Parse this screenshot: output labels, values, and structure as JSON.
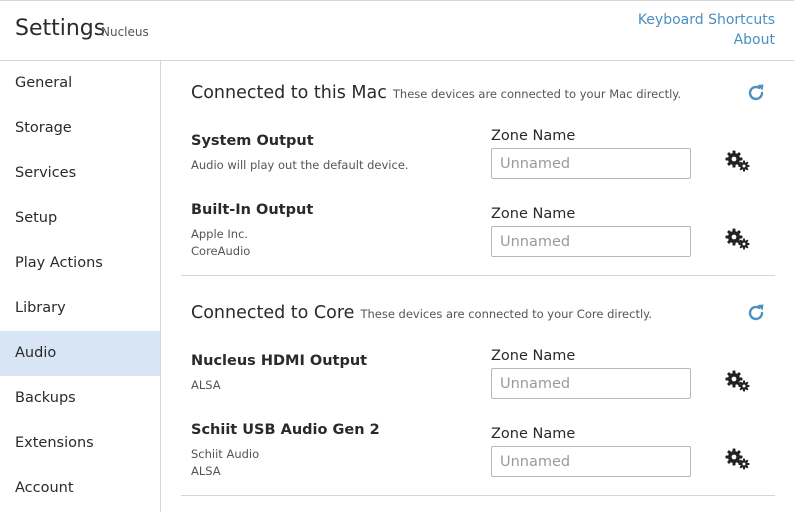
{
  "header": {
    "title": "Settings",
    "subtitle": "Nucleus",
    "keyboard_shortcuts": "Keyboard Shortcuts",
    "about": "About"
  },
  "sidebar": {
    "active": "Audio",
    "items": [
      {
        "label": "General"
      },
      {
        "label": "Storage"
      },
      {
        "label": "Services"
      },
      {
        "label": "Setup"
      },
      {
        "label": "Play Actions"
      },
      {
        "label": "Library"
      },
      {
        "label": "Audio"
      },
      {
        "label": "Backups"
      },
      {
        "label": "Extensions"
      },
      {
        "label": "Account"
      }
    ]
  },
  "sections": [
    {
      "title": "Connected to this Mac",
      "description": "These devices are connected to your Mac directly.",
      "refresh_icon": "refresh-icon",
      "devices": [
        {
          "name": "System Output",
          "sub1": "Audio will play out the default device.",
          "sub2": "",
          "zone_label": "Zone Name",
          "zone_value": "",
          "zone_placeholder": "Unnamed",
          "settings_icon": "gears-icon"
        },
        {
          "name": "Built-In Output",
          "sub1": "Apple Inc.",
          "sub2": "CoreAudio",
          "zone_label": "Zone Name",
          "zone_value": "",
          "zone_placeholder": "Unnamed",
          "settings_icon": "gears-icon"
        }
      ]
    },
    {
      "title": "Connected to Core",
      "description": "These devices are connected to your Core directly.",
      "refresh_icon": "refresh-icon",
      "devices": [
        {
          "name": "Nucleus HDMI Output",
          "sub1": "ALSA",
          "sub2": "",
          "zone_label": "Zone Name",
          "zone_value": "",
          "zone_placeholder": "Unnamed",
          "settings_icon": "gears-icon"
        },
        {
          "name": "Schiit USB Audio Gen 2",
          "sub1": "Schiit Audio",
          "sub2": "ALSA",
          "zone_label": "Zone Name",
          "zone_value": "",
          "zone_placeholder": "Unnamed",
          "settings_icon": "gears-icon"
        }
      ]
    }
  ],
  "colors": {
    "accent": "#4a90c2",
    "active_bg": "#d7e5f4",
    "border": "#d6d6d6"
  }
}
